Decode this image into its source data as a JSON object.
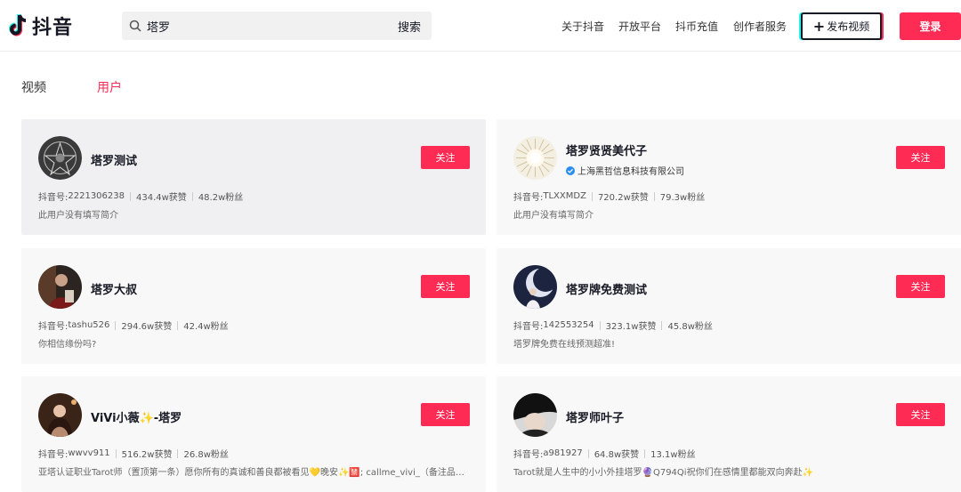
{
  "header": {
    "logo_text": "抖音",
    "search": {
      "value": "塔罗",
      "button": "搜索"
    },
    "nav": [
      "关于抖音",
      "开放平台",
      "抖币充值",
      "创作者服务"
    ],
    "upload_label": "发布视频",
    "login_label": "登录"
  },
  "tabs": {
    "video": "视频",
    "user": "用户",
    "active": "user"
  },
  "colors": {
    "accent": "#fe2c55",
    "cyan": "#25f4ee",
    "verified": "#2a8ef0"
  },
  "labels": {
    "follow": "关注",
    "douyin_id_prefix": "抖音号: "
  },
  "users": [
    {
      "name": "塔罗测试",
      "verified": "",
      "douyin_id": "2221306238",
      "likes": "434.4w获赞",
      "fans": "48.2w粉丝",
      "bio": "此用户没有填写简介",
      "avatar_icon": "tarot-sigil-avatar"
    },
    {
      "name": "塔罗贤贤美代子",
      "verified": "上海黑哲信息科技有限公司",
      "douyin_id": "TLXXMDZ",
      "likes": "720.2w获赞",
      "fans": "79.3w粉丝",
      "bio": "此用户没有填写简介",
      "avatar_icon": "sunburst-avatar"
    },
    {
      "name": "塔罗大叔",
      "verified": "",
      "douyin_id": "tashu526",
      "likes": "294.6w获赞",
      "fans": "42.4w粉丝",
      "bio": "你相信缘份吗?",
      "avatar_icon": "man-portrait-avatar"
    },
    {
      "name": "塔罗牌免费测试",
      "verified": "",
      "douyin_id": "142553254",
      "likes": "323.1w获赞",
      "fans": "45.8w粉丝",
      "bio": "塔罗牌免费在线预测超准!",
      "avatar_icon": "moon-night-avatar"
    },
    {
      "name": "ViVi小薇✨-塔罗",
      "verified": "",
      "douyin_id": "wwvv911",
      "likes": "516.2w获赞",
      "fans": "26.8w粉丝",
      "bio": "亚塔认证职业Tarot师（置顶第一条）愿你所有的真诚和善良都被看见💛晚安✨🈲; callme_vivi_（备注品…",
      "avatar_icon": "woman-portrait-avatar"
    },
    {
      "name": "塔罗师叶子",
      "verified": "",
      "douyin_id": "a981927",
      "likes": "64.8w获赞",
      "fans": "13.1w粉丝",
      "bio": "Tarot就是人生中的小小外挂塔罗🔮Q794Qi祝你们在感情里都能双向奔赴✨",
      "avatar_icon": "woman-closeup-avatar"
    }
  ]
}
